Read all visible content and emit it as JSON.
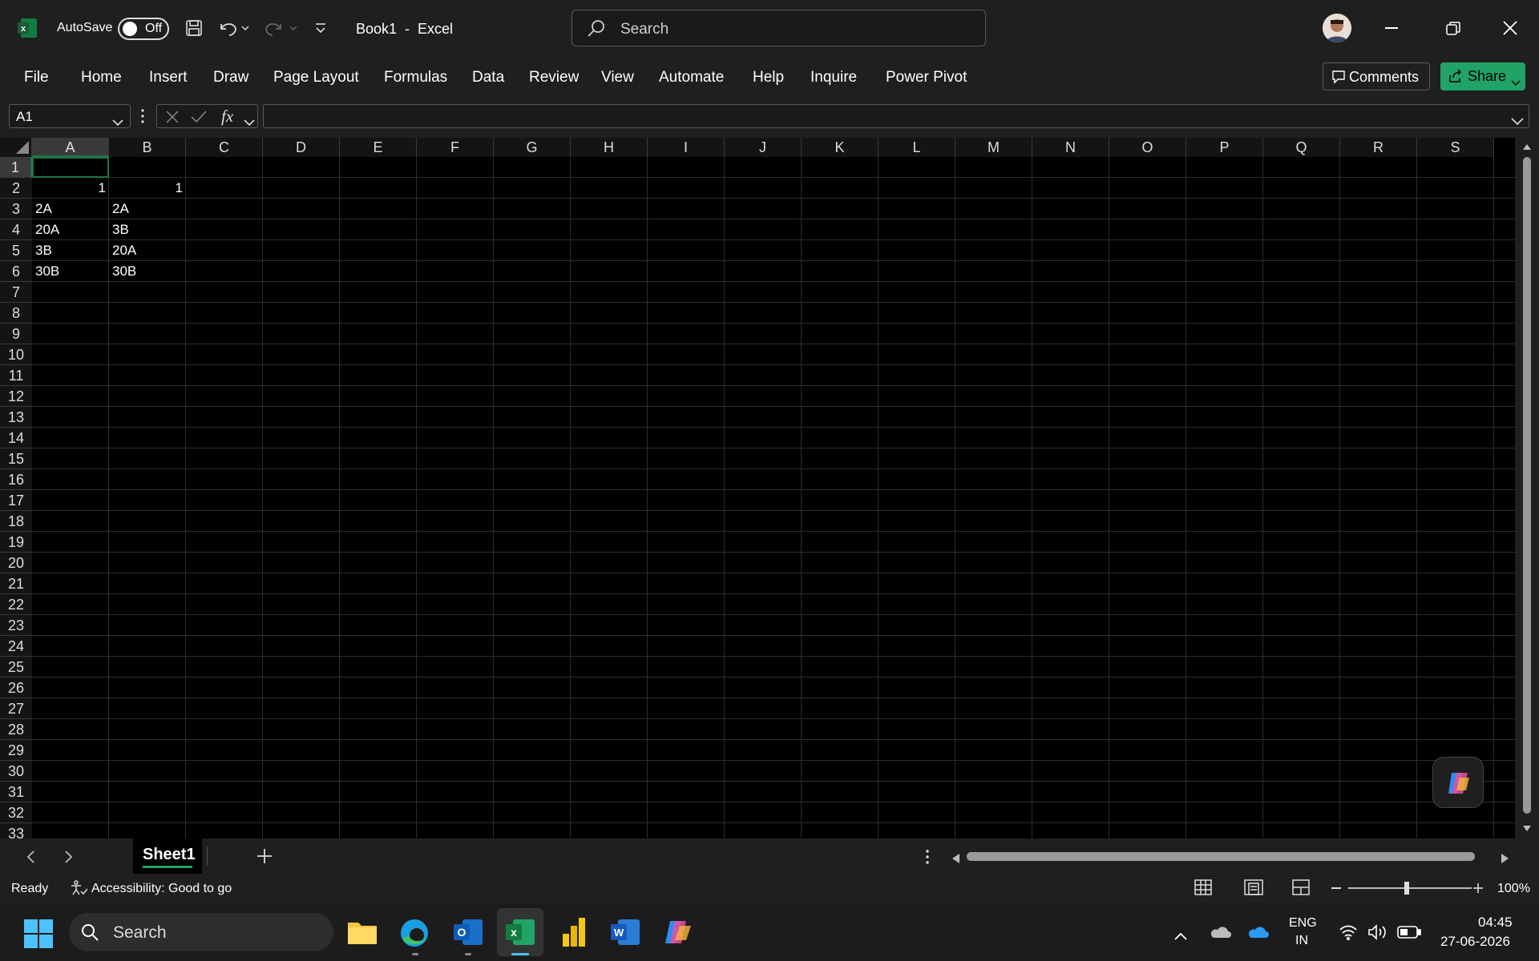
{
  "titlebar": {
    "autosave_label": "AutoSave",
    "autosave_state": "Off",
    "doc_title": "Book1  -  Excel",
    "search_placeholder": "Search"
  },
  "ribbon": {
    "tabs": [
      "File",
      "Home",
      "Insert",
      "Draw",
      "Page Layout",
      "Formulas",
      "Data",
      "Review",
      "View",
      "Automate",
      "Help",
      "Inquire",
      "Power Pivot"
    ],
    "comments_label": "Comments",
    "share_label": "Share"
  },
  "formula_bar": {
    "name_box": "A1",
    "fx": "fx",
    "value": ""
  },
  "grid": {
    "columns": [
      "A",
      "B",
      "C",
      "D",
      "E",
      "F",
      "G",
      "H",
      "I",
      "J",
      "K",
      "L",
      "M",
      "N",
      "O",
      "P",
      "Q",
      "R",
      "S"
    ],
    "rows": [
      "1",
      "2",
      "3",
      "4",
      "5",
      "6",
      "7",
      "8",
      "9",
      "10",
      "11",
      "12",
      "13",
      "14",
      "15",
      "16",
      "17",
      "18",
      "19",
      "20",
      "21",
      "22",
      "23",
      "24",
      "25",
      "26",
      "27",
      "28",
      "29",
      "30",
      "31",
      "32",
      "33"
    ],
    "cells": {
      "A2": "1",
      "B2": "1",
      "A3": "2A",
      "B3": "2A",
      "A4": "20A",
      "B4": "3B",
      "A5": "3B",
      "B5": "20A",
      "A6": "30B",
      "B6": "30B"
    },
    "selected_cell": "A1"
  },
  "sheets": {
    "tabs": [
      "Sheet1"
    ],
    "active": "Sheet1"
  },
  "status": {
    "ready": "Ready",
    "accessibility": "Accessibility: Good to go",
    "zoom": "100%"
  },
  "taskbar": {
    "search_placeholder": "Search",
    "lang_line1": "ENG",
    "lang_line2": "IN",
    "time": "04:45",
    "date": "27-06-2026"
  },
  "colors": {
    "accent": "#21a366",
    "selection": "#217346"
  }
}
